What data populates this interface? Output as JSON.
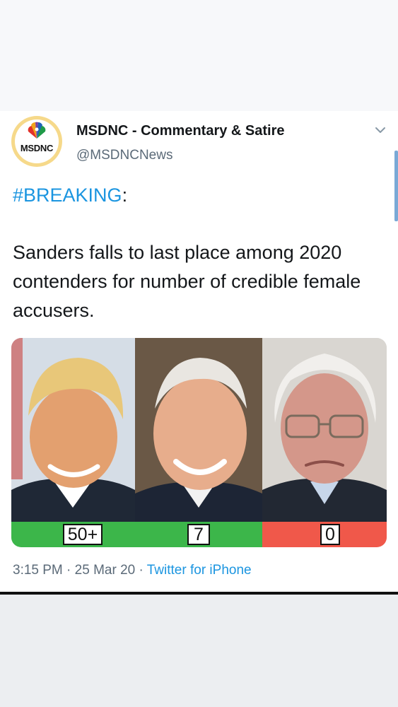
{
  "account": {
    "display_name": "MSDNC - Commentary & Satire",
    "handle": "@MSDNCNews",
    "avatar_text": "MSDNC"
  },
  "tweet": {
    "hashtag": "#BREAKING",
    "hashtag_suffix": ":",
    "text": "Sanders falls to last place among 2020 contenders for number of credible female accusers."
  },
  "media": {
    "panels": [
      {
        "label": "50+",
        "bar_color": "#3cb64a"
      },
      {
        "label": "7",
        "bar_color": "#3cb64a"
      },
      {
        "label": "0",
        "bar_color": "#f0584a"
      }
    ]
  },
  "meta": {
    "time": "3:15 PM",
    "separator": "·",
    "date": "25 Mar 20",
    "source": "Twitter for iPhone"
  },
  "colors": {
    "link": "#1b95e0",
    "secondary_text": "#5b6a78",
    "primary_text": "#14171a"
  },
  "icons": {
    "menu": "chevron-down-icon",
    "logo": "peacock-icon"
  }
}
